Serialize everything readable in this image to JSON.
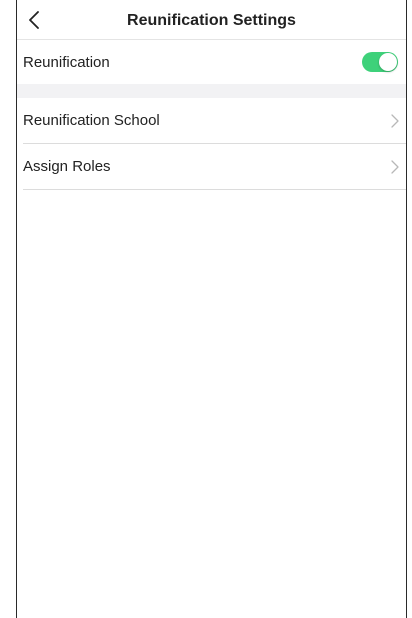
{
  "header": {
    "title": "Reunification Settings",
    "back_icon": "chevron-left-icon"
  },
  "settings": {
    "reunification": {
      "label": "Reunification",
      "enabled": true,
      "toggle_color": "#3ed17a"
    },
    "items": [
      {
        "label": "Reunification School",
        "icon": "chevron-right-icon"
      },
      {
        "label": "Assign Roles",
        "icon": "chevron-right-icon"
      }
    ]
  },
  "colors": {
    "divider_band": "#f2f2f4",
    "separator": "#dcdcdc",
    "chevron": "#b8b8b8"
  }
}
